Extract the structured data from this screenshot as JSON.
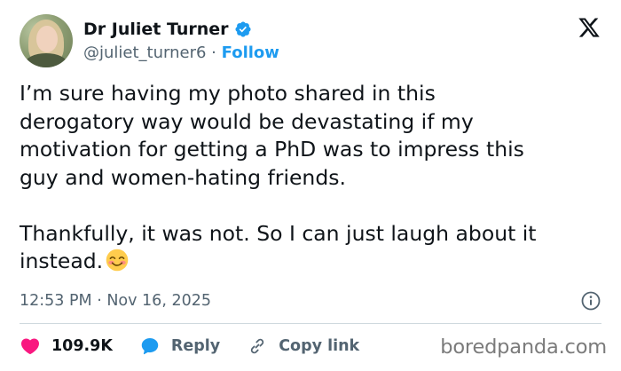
{
  "author": {
    "name": "Dr Juliet Turner",
    "handle": "@juliet_turner6",
    "separator": "·",
    "follow_label": "Follow",
    "verified": true,
    "verified_color": "#1d9bf0",
    "avatar_icon": "profile-photo"
  },
  "platform": {
    "logo_icon": "x-logo"
  },
  "post": {
    "text_paragraph_1": "I’m sure having my photo shared in this\nderogatory way would be devastating if my\nmotivation for getting a PhD was to impress this\nguy and women-hating friends.",
    "text_paragraph_2": "Thankfully, it was not. So I can just laugh about it\ninstead.",
    "emoji": "smiling-face-with-smiling-eyes",
    "timestamp": "12:53 PM · Nov 16, 2025"
  },
  "actions": {
    "like_count": "109.9K",
    "like_color": "#f91880",
    "reply_label": "Reply",
    "reply_color": "#1d9bf0",
    "copy_link_label": "Copy link"
  },
  "watermark": {
    "text": "boredpanda.com"
  },
  "colors": {
    "text_primary": "#0f1419",
    "text_secondary": "#536471",
    "accent": "#1d9bf0",
    "divider": "#cfd9de"
  }
}
